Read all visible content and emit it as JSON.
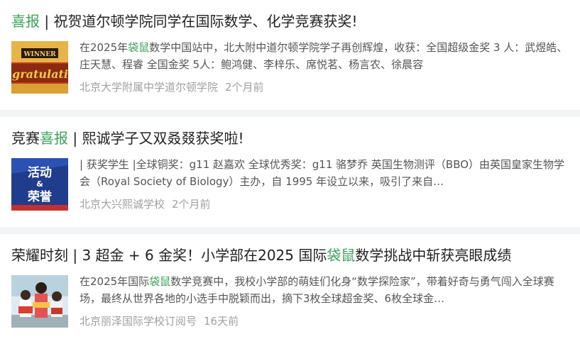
{
  "items": [
    {
      "title_highlight": "喜报",
      "title_rest": " | 祝贺道尔顿学院同学在国际数学、化学竞赛获奖!",
      "desc_pre": "在2025年",
      "desc_hl": "袋鼠",
      "desc_post": "数学中国站中，北大附中道尔顿学院学子再创辉煌，收获：全国超级金奖 3 人：武煜皓、庄天慧、程睿 全国金奖 5人：鲍鸿健、李梓乐、席悦茗、杨言农、徐晨容",
      "source": "北京大学附属中学道尔顿学院",
      "time": "2个月前",
      "thumb_text_top": "WINNER",
      "thumb_text_main": "ngratulatio"
    },
    {
      "title_pre": "竞赛",
      "title_highlight": "喜报",
      "title_rest": " | 熙诚学子又双叒叕获奖啦!",
      "desc": "| 获奖学生 |全球铜奖：g11 赵嘉欢 全球优秀奖：g11 骆梦乔 英国生物测评（BBO）由英国皇家生物学会（Royal Society of Biology）主办，自 1995 年设立以来，吸引了来自…",
      "source": "北京大兴熙诚学校",
      "time": "2个月前",
      "thumb_line1": "活动",
      "thumb_line2": "&",
      "thumb_line3": "荣誉"
    },
    {
      "title_pre": "荣耀时刻 | 3 超金 + 6 金奖！小学部在2025 国际",
      "title_highlight": "袋鼠",
      "title_rest": "数学挑战中斩获亮眼成绩",
      "desc_pre": "在2025年国际",
      "desc_hl": "袋鼠",
      "desc_post": "数学竞赛中，我校小学部的萌娃们化身“数学探险家”，带着好奇与勇气闯入全球赛场，最终从世界各地的小选手中脱颖而出，摘下3枚全球超金奖、6枚全球金…",
      "source": "北京丽泽国际学校订阅号",
      "time": "16天前"
    }
  ],
  "colors": {
    "highlight": "#3aa35a",
    "meta": "#a0a0a0"
  }
}
